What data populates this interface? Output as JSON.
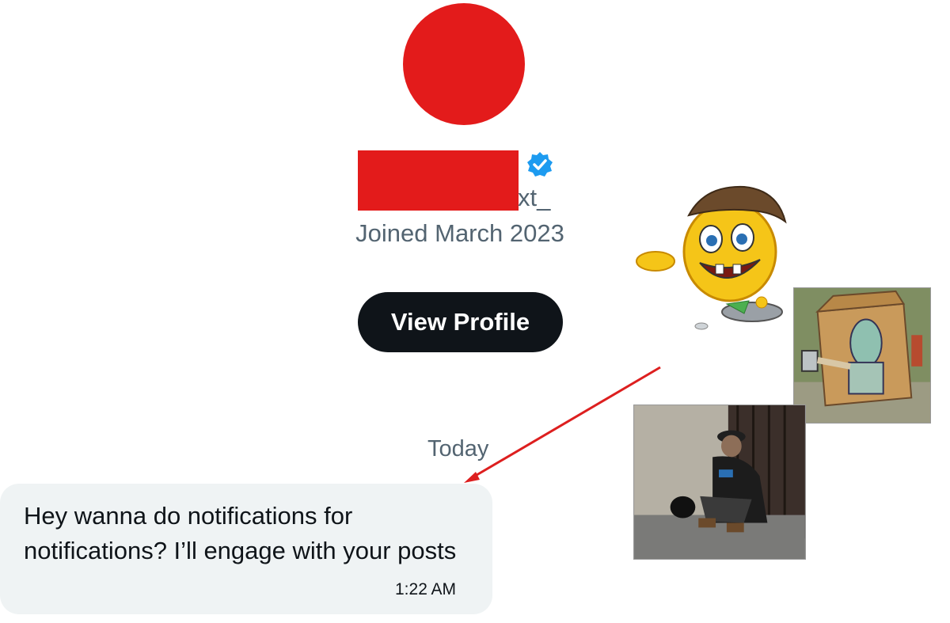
{
  "profile": {
    "handle_fragment": "xt_",
    "joined_text": "Joined March 2023",
    "view_profile_label": "View Profile",
    "avatar_color": "#e31b1b",
    "verified_color": "#1d9bf0"
  },
  "conversation": {
    "date_divider": "Today",
    "messages": [
      {
        "text": "Hey wanna do notifications for notifications? I’ll engage with your posts",
        "time": "1:22 AM"
      }
    ]
  },
  "annotations": {
    "arrow_color": "#dd1f1f",
    "images": [
      "begging-emoji",
      "squidward-cardboard-box",
      "man-sitting-on-sidewalk"
    ]
  }
}
